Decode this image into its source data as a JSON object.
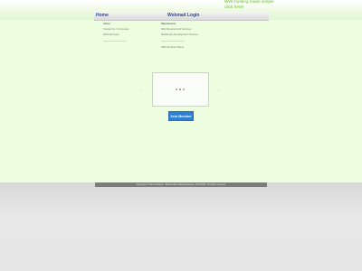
{
  "promo": {
    "line1": "Web hosting make simple",
    "line2": "click here!"
  },
  "nav": {
    "home": "Home",
    "webmail": "Webmail Login"
  },
  "left_col": {
    "title": "About",
    "items": [
      "Contact Us / Comments",
      "Webmail Login"
    ]
  },
  "right_col": {
    "title": "Departments",
    "items": [
      "Web Development Services",
      "Mobile App Development Services",
      "SEO Services Status"
    ]
  },
  "slideshow": {
    "prev": "‹",
    "next": "›"
  },
  "cta": {
    "join": "Join Member"
  },
  "footer": {
    "text": "Copyright © Web Solutions - Bandar Baru Bangi Selangor, 2010-2011. All rights reserved."
  },
  "colors": {
    "accent": "#2f7fd4",
    "nav_text": "#2a4aa0",
    "promo": "#5fbf2a",
    "background": "#ecfde0"
  }
}
